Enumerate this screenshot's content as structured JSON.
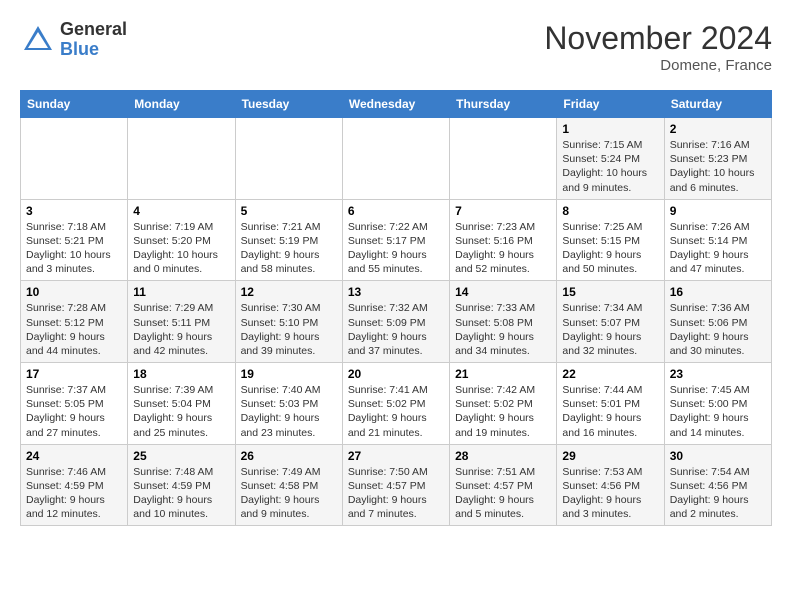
{
  "header": {
    "logo_general": "General",
    "logo_blue": "Blue",
    "month_title": "November 2024",
    "location": "Domene, France"
  },
  "days_of_week": [
    "Sunday",
    "Monday",
    "Tuesday",
    "Wednesday",
    "Thursday",
    "Friday",
    "Saturday"
  ],
  "weeks": [
    [
      {
        "day": "",
        "info": ""
      },
      {
        "day": "",
        "info": ""
      },
      {
        "day": "",
        "info": ""
      },
      {
        "day": "",
        "info": ""
      },
      {
        "day": "",
        "info": ""
      },
      {
        "day": "1",
        "info": "Sunrise: 7:15 AM\nSunset: 5:24 PM\nDaylight: 10 hours and 9 minutes."
      },
      {
        "day": "2",
        "info": "Sunrise: 7:16 AM\nSunset: 5:23 PM\nDaylight: 10 hours and 6 minutes."
      }
    ],
    [
      {
        "day": "3",
        "info": "Sunrise: 7:18 AM\nSunset: 5:21 PM\nDaylight: 10 hours and 3 minutes."
      },
      {
        "day": "4",
        "info": "Sunrise: 7:19 AM\nSunset: 5:20 PM\nDaylight: 10 hours and 0 minutes."
      },
      {
        "day": "5",
        "info": "Sunrise: 7:21 AM\nSunset: 5:19 PM\nDaylight: 9 hours and 58 minutes."
      },
      {
        "day": "6",
        "info": "Sunrise: 7:22 AM\nSunset: 5:17 PM\nDaylight: 9 hours and 55 minutes."
      },
      {
        "day": "7",
        "info": "Sunrise: 7:23 AM\nSunset: 5:16 PM\nDaylight: 9 hours and 52 minutes."
      },
      {
        "day": "8",
        "info": "Sunrise: 7:25 AM\nSunset: 5:15 PM\nDaylight: 9 hours and 50 minutes."
      },
      {
        "day": "9",
        "info": "Sunrise: 7:26 AM\nSunset: 5:14 PM\nDaylight: 9 hours and 47 minutes."
      }
    ],
    [
      {
        "day": "10",
        "info": "Sunrise: 7:28 AM\nSunset: 5:12 PM\nDaylight: 9 hours and 44 minutes."
      },
      {
        "day": "11",
        "info": "Sunrise: 7:29 AM\nSunset: 5:11 PM\nDaylight: 9 hours and 42 minutes."
      },
      {
        "day": "12",
        "info": "Sunrise: 7:30 AM\nSunset: 5:10 PM\nDaylight: 9 hours and 39 minutes."
      },
      {
        "day": "13",
        "info": "Sunrise: 7:32 AM\nSunset: 5:09 PM\nDaylight: 9 hours and 37 minutes."
      },
      {
        "day": "14",
        "info": "Sunrise: 7:33 AM\nSunset: 5:08 PM\nDaylight: 9 hours and 34 minutes."
      },
      {
        "day": "15",
        "info": "Sunrise: 7:34 AM\nSunset: 5:07 PM\nDaylight: 9 hours and 32 minutes."
      },
      {
        "day": "16",
        "info": "Sunrise: 7:36 AM\nSunset: 5:06 PM\nDaylight: 9 hours and 30 minutes."
      }
    ],
    [
      {
        "day": "17",
        "info": "Sunrise: 7:37 AM\nSunset: 5:05 PM\nDaylight: 9 hours and 27 minutes."
      },
      {
        "day": "18",
        "info": "Sunrise: 7:39 AM\nSunset: 5:04 PM\nDaylight: 9 hours and 25 minutes."
      },
      {
        "day": "19",
        "info": "Sunrise: 7:40 AM\nSunset: 5:03 PM\nDaylight: 9 hours and 23 minutes."
      },
      {
        "day": "20",
        "info": "Sunrise: 7:41 AM\nSunset: 5:02 PM\nDaylight: 9 hours and 21 minutes."
      },
      {
        "day": "21",
        "info": "Sunrise: 7:42 AM\nSunset: 5:02 PM\nDaylight: 9 hours and 19 minutes."
      },
      {
        "day": "22",
        "info": "Sunrise: 7:44 AM\nSunset: 5:01 PM\nDaylight: 9 hours and 16 minutes."
      },
      {
        "day": "23",
        "info": "Sunrise: 7:45 AM\nSunset: 5:00 PM\nDaylight: 9 hours and 14 minutes."
      }
    ],
    [
      {
        "day": "24",
        "info": "Sunrise: 7:46 AM\nSunset: 4:59 PM\nDaylight: 9 hours and 12 minutes."
      },
      {
        "day": "25",
        "info": "Sunrise: 7:48 AM\nSunset: 4:59 PM\nDaylight: 9 hours and 10 minutes."
      },
      {
        "day": "26",
        "info": "Sunrise: 7:49 AM\nSunset: 4:58 PM\nDaylight: 9 hours and 9 minutes."
      },
      {
        "day": "27",
        "info": "Sunrise: 7:50 AM\nSunset: 4:57 PM\nDaylight: 9 hours and 7 minutes."
      },
      {
        "day": "28",
        "info": "Sunrise: 7:51 AM\nSunset: 4:57 PM\nDaylight: 9 hours and 5 minutes."
      },
      {
        "day": "29",
        "info": "Sunrise: 7:53 AM\nSunset: 4:56 PM\nDaylight: 9 hours and 3 minutes."
      },
      {
        "day": "30",
        "info": "Sunrise: 7:54 AM\nSunset: 4:56 PM\nDaylight: 9 hours and 2 minutes."
      }
    ]
  ]
}
